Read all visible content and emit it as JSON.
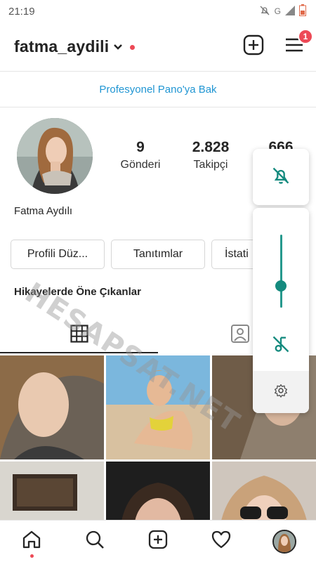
{
  "status_bar": {
    "time": "21:19",
    "network": "G"
  },
  "header": {
    "username": "fatma_aydili",
    "menu_badge": "1"
  },
  "professional_link": "Profesyonel Pano'ya Bak",
  "profile": {
    "full_name": "Fatma Aydılı",
    "stats": [
      {
        "value": "9",
        "label": "Gönderi"
      },
      {
        "value": "2.828",
        "label": "Takipçi"
      },
      {
        "value": "666",
        "label": ""
      }
    ],
    "buttons": {
      "edit": "Profili Düz...",
      "promotions": "Tanıtımlar",
      "insights": "İstati"
    },
    "highlights_title": "Hikayelerde Öne Çıkanlar"
  },
  "volume_panel": {
    "level": 0.3
  },
  "watermark": "HESAPSAT.NET",
  "colors": {
    "accent_blue": "#2196d3",
    "badge_red": "#ed4956",
    "volume_teal": "#148a7e"
  }
}
